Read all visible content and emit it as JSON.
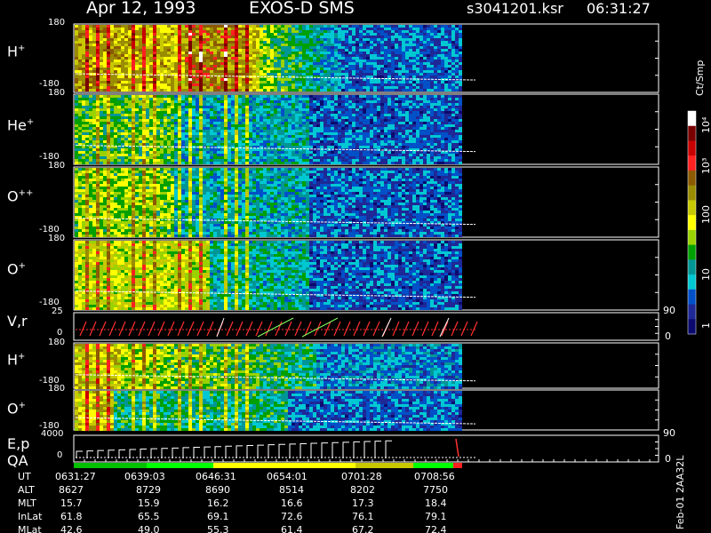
{
  "header": {
    "date": "Apr 12, 1993",
    "instrument": "EXOS-D SMS",
    "file": "s3041201.ksr",
    "time": "06:31:27"
  },
  "panels": [
    {
      "label": "H",
      "sup": "+",
      "top": "180",
      "bottom": "-180"
    },
    {
      "label": "He",
      "sup": "+",
      "top": "180",
      "bottom": "-180"
    },
    {
      "label": "O",
      "sup": "++",
      "top": "180",
      "bottom": "-180"
    },
    {
      "label": "O",
      "sup": "+",
      "top": "180",
      "bottom": "-180"
    },
    {
      "label": "V,r",
      "sup": "",
      "top": "25",
      "bottom": "0"
    },
    {
      "label": "H",
      "sup": "+",
      "top": "180",
      "bottom": "-180"
    },
    {
      "label": "O",
      "sup": "+",
      "top": "180",
      "bottom": "-180"
    },
    {
      "label": "E,p",
      "sup": "",
      "top": "4000",
      "bottom": "0"
    }
  ],
  "qa_label": "QA",
  "right_axis": {
    "vr_top": "90",
    "vr_bottom": "0",
    "ep_top": "90",
    "ep_bottom": "0"
  },
  "colorbar": {
    "unit": "Ct/Smp",
    "ticks": [
      "10⁴",
      "10³",
      "100",
      "10",
      "1"
    ],
    "colors": [
      "#ffffff",
      "#7a0000",
      "#c80000",
      "#ff2020",
      "#8c5a00",
      "#9a8c00",
      "#c8c800",
      "#ffff00",
      "#9ad200",
      "#00a000",
      "#009696",
      "#00c8d2",
      "#0050c8",
      "#1e2896",
      "#0a0a6e"
    ]
  },
  "side_label": "Feb-01 2AA32L",
  "footer": {
    "rows": [
      {
        "name": "UT",
        "values": [
          "0631:27",
          "0639:03",
          "0646:31",
          "0654:01",
          "0701:28",
          "0708:56"
        ]
      },
      {
        "name": "ALT",
        "values": [
          "8627",
          "8729",
          "8690",
          "8514",
          "8202",
          "7750"
        ]
      },
      {
        "name": "MLT",
        "values": [
          "15.7",
          "15.9",
          "16.2",
          "16.6",
          "17.3",
          "18.4"
        ]
      },
      {
        "name": "InLat",
        "values": [
          "61.8",
          "65.5",
          "69.1",
          "72.6",
          "76.1",
          "79.1"
        ]
      },
      {
        "name": "MLat",
        "values": [
          "42.6",
          "49.0",
          "55.3",
          "61.4",
          "67.2",
          "72.4"
        ]
      }
    ]
  },
  "chart_data": {
    "type": "heatmap",
    "title": "Apr 12, 1993 EXOS-D SMS",
    "xlabel": "UT",
    "x_ticks": [
      "0631:27",
      "0639:03",
      "0646:31",
      "0654:01",
      "0701:28",
      "0708:56"
    ],
    "series": [
      {
        "name": "H+",
        "ylim": [
          -180,
          180
        ]
      },
      {
        "name": "He+",
        "ylim": [
          -180,
          180
        ]
      },
      {
        "name": "O++",
        "ylim": [
          -180,
          180
        ]
      },
      {
        "name": "O+",
        "ylim": [
          -180,
          180
        ]
      },
      {
        "name": "V,r",
        "ylim": [
          0,
          25
        ],
        "right_ylim": [
          0,
          90
        ]
      },
      {
        "name": "H+",
        "ylim": [
          -180,
          180
        ]
      },
      {
        "name": "O+",
        "ylim": [
          -180,
          180
        ]
      },
      {
        "name": "E,p",
        "ylim": [
          0,
          4000
        ],
        "right_ylim": [
          0,
          90
        ]
      }
    ],
    "colorbar_unit": "Ct/Smp",
    "colorbar_range": [
      1,
      10000
    ],
    "colorbar_scale": "log"
  }
}
